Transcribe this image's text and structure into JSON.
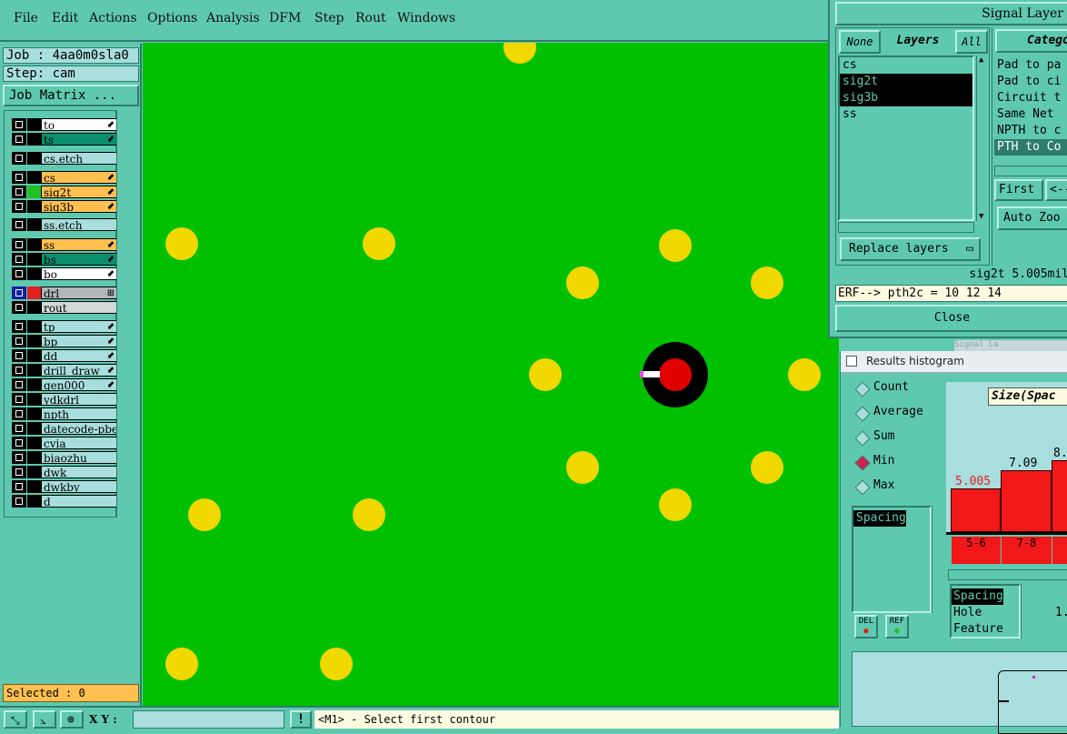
{
  "menu": [
    "File",
    "Edit",
    "Actions",
    "Options",
    "Analysis",
    "DFM",
    "Step",
    "Rout",
    "Windows"
  ],
  "job": {
    "label": "Job : 4aa0m0sla0",
    "step": "Step: cam",
    "matrix_button": "Job Matrix ..."
  },
  "layers": [
    {
      "name": "to",
      "color": "#ffffff",
      "swatch": "#000000",
      "flag": "⬋"
    },
    {
      "name": "ts",
      "color": "#0b8f6f",
      "swatch": "#000000",
      "flag": "⬋"
    },
    {
      "name": "cs.etch",
      "color": "#a8dedd",
      "swatch": "",
      "flag": ""
    },
    {
      "name": "cs",
      "color": "#ffc050",
      "swatch": "#000000",
      "flag": "⬋"
    },
    {
      "name": "sig2t",
      "color": "#ffc050",
      "swatch": "#22c022",
      "flag": "⬋"
    },
    {
      "name": "sig3b",
      "color": "#ffc050",
      "swatch": "#000000",
      "flag": "⬋"
    },
    {
      "name": "ss.etch",
      "color": "#a8dedd",
      "swatch": "",
      "flag": ""
    },
    {
      "name": "ss",
      "color": "#ffc050",
      "swatch": "#000000",
      "flag": "⬋"
    },
    {
      "name": "bs",
      "color": "#0b8f6f",
      "swatch": "#000000",
      "flag": "⬋"
    },
    {
      "name": "bo",
      "color": "#ffffff",
      "swatch": "#000000",
      "flag": "⬋"
    },
    {
      "name": "drl",
      "color": "#b0b8bc",
      "swatch": "#e02020",
      "flag": "⊞"
    },
    {
      "name": "rout",
      "color": "#d0d8d8",
      "swatch": "",
      "flag": ""
    },
    {
      "name": "tp",
      "color": "#a8dedd",
      "swatch": "#000000",
      "flag": "⬋"
    },
    {
      "name": "bp",
      "color": "#a8dedd",
      "swatch": "#000000",
      "flag": "⬋"
    },
    {
      "name": "dd",
      "color": "#a8dedd",
      "swatch": "#000000",
      "flag": "⬋"
    },
    {
      "name": "drill_draw",
      "color": "#a8dedd",
      "swatch": "#000000",
      "flag": "⬋"
    },
    {
      "name": "gen000",
      "color": "#a8dedd",
      "swatch": "#000000",
      "flag": "⬋"
    },
    {
      "name": "ydkdrl",
      "color": "#a8dedd",
      "swatch": "",
      "flag": ""
    },
    {
      "name": "npth",
      "color": "#a8dedd",
      "swatch": "",
      "flag": ""
    },
    {
      "name": "datecode-pbe",
      "color": "#a8dedd",
      "swatch": "",
      "flag": ""
    },
    {
      "name": "cvia",
      "color": "#a8dedd",
      "swatch": "",
      "flag": ""
    },
    {
      "name": "biaozhu",
      "color": "#a8dedd",
      "swatch": "",
      "flag": ""
    },
    {
      "name": "dwk",
      "color": "#a8dedd",
      "swatch": "",
      "flag": ""
    },
    {
      "name": "dwkby",
      "color": "#a8dedd",
      "swatch": "",
      "flag": ""
    },
    {
      "name": "d",
      "color": "#a8dedd",
      "swatch": "",
      "flag": ""
    }
  ],
  "selected": "Selected : 0",
  "status": {
    "xy_label": "X Y :",
    "xy_value": "",
    "prompt_icon": "!",
    "message": "<M1> - Select first contour"
  },
  "signal_dialog": {
    "title": "Signal Layer",
    "tabs": {
      "none": "None",
      "layers": "Layers",
      "all": "All",
      "category": "Catego"
    },
    "layer_list": [
      "cs",
      "sig2t",
      "sig3b",
      "ss"
    ],
    "selected_layers": [
      "sig2t",
      "sig3b"
    ],
    "categories": [
      "Pad to pa",
      "Pad to ci",
      "Circuit t",
      "Same Net",
      "NPTH to c",
      "PTH to Co"
    ],
    "first": "First",
    "prev": "<--",
    "auto_zoom": "Auto Zoo",
    "replace": "Replace layers",
    "readout": "sig2t 5.005mil",
    "erf": "ERF--> pth2c = 10 12 14",
    "close": "Close"
  },
  "histogram": {
    "title": "Results histogram",
    "modes": [
      "Count",
      "Average",
      "Sum",
      "Min",
      "Max"
    ],
    "selected_mode": "Min",
    "left_list": [
      "Spacing"
    ],
    "chart_title": "Size(Spac",
    "bars": [
      {
        "value": "5.005",
        "range": "5-6"
      },
      {
        "value": "7.09",
        "range": "7-8"
      },
      {
        "value": "8.",
        "range": ""
      }
    ],
    "types": [
      "Spacing",
      "Hole",
      "Feature"
    ],
    "del": "DEL",
    "ref": "REF",
    "partial": "1."
  },
  "background_window": "Signal La"
}
